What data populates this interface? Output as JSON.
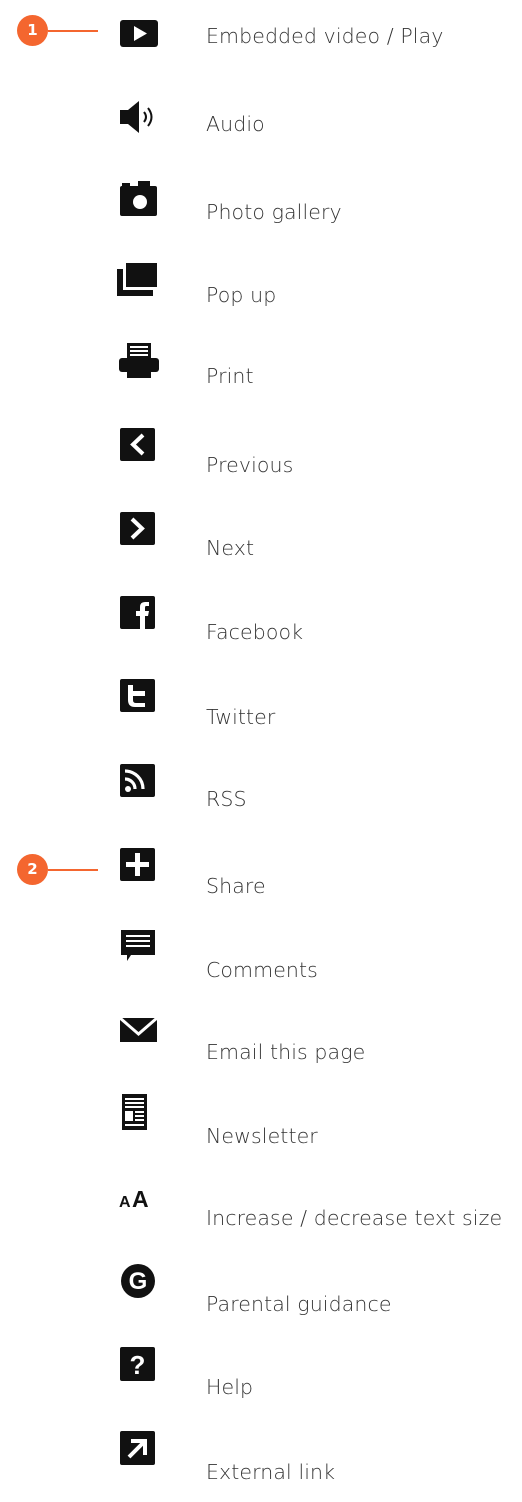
{
  "accent_color": "#f4662f",
  "markers": [
    {
      "number": "1",
      "row": "Embedded video / Play"
    },
    {
      "number": "2",
      "row": "Share"
    }
  ],
  "items": [
    {
      "icon": "play-icon",
      "label": "Embedded video / Play"
    },
    {
      "icon": "audio-icon",
      "label": "Audio"
    },
    {
      "icon": "camera-icon",
      "label": "Photo gallery"
    },
    {
      "icon": "popup-icon",
      "label": "Pop up"
    },
    {
      "icon": "print-icon",
      "label": "Print"
    },
    {
      "icon": "previous-icon",
      "label": "Previous"
    },
    {
      "icon": "next-icon",
      "label": "Next"
    },
    {
      "icon": "facebook-icon",
      "label": "Facebook"
    },
    {
      "icon": "twitter-icon",
      "label": "Twitter"
    },
    {
      "icon": "rss-icon",
      "label": "RSS"
    },
    {
      "icon": "share-icon",
      "label": "Share"
    },
    {
      "icon": "comments-icon",
      "label": "Comments"
    },
    {
      "icon": "email-icon",
      "label": "Email this page"
    },
    {
      "icon": "newsletter-icon",
      "label": "Newsletter"
    },
    {
      "icon": "text-size-icon",
      "label": "Increase / decrease text size",
      "glyph": "AA"
    },
    {
      "icon": "parental-guidance-icon",
      "label": "Parental guidance",
      "glyph": "G"
    },
    {
      "icon": "help-icon",
      "label": "Help",
      "glyph": "?"
    },
    {
      "icon": "external-link-icon",
      "label": "External link"
    }
  ]
}
